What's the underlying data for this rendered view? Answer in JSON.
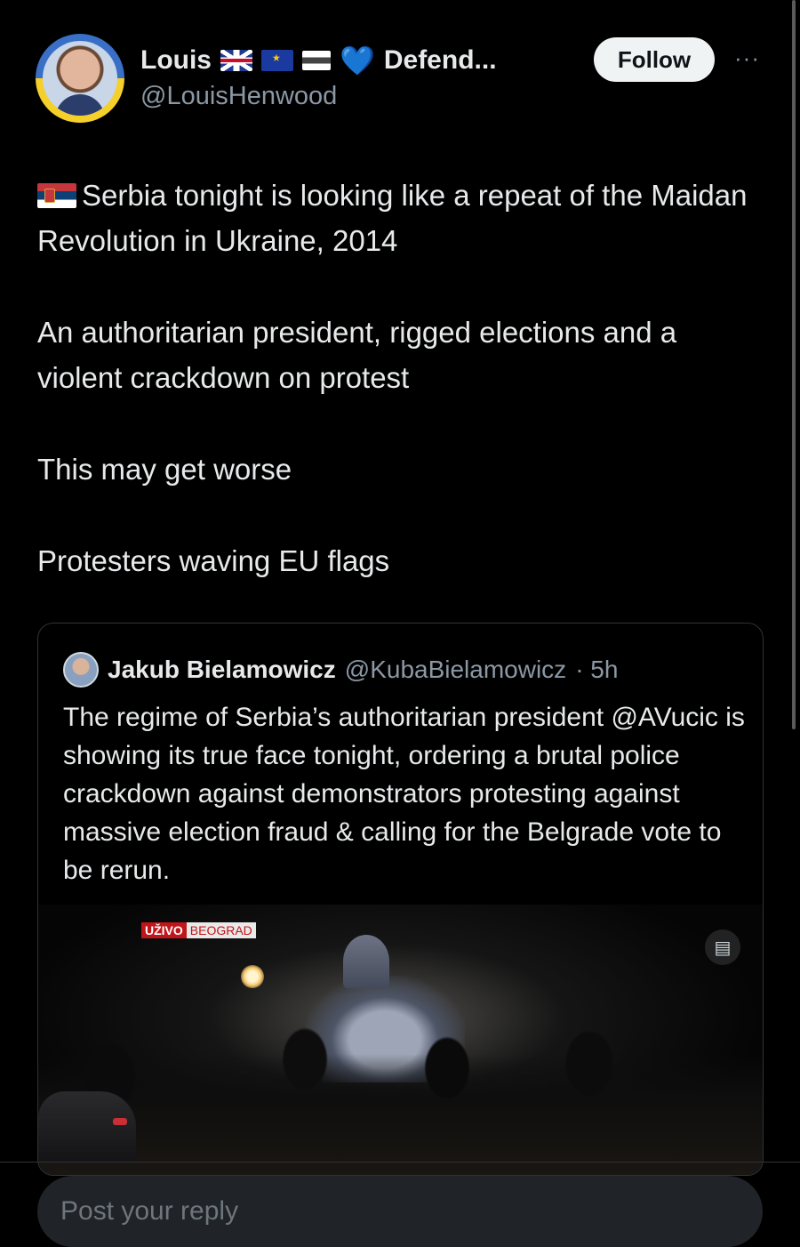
{
  "author": {
    "name": "Louis",
    "flags": [
      "uk-flag",
      "eu-flag",
      "estonia-flag",
      "heart"
    ],
    "name_suffix": "Defend...",
    "handle": "@LouisHenwood",
    "follow_label": "Follow",
    "more_label": "···"
  },
  "tweet": {
    "paragraphs": [
      "Serbia tonight is looking like a repeat of the Maidan Revolution in Ukraine, 2014",
      "An authoritarian president, rigged elections and a violent crackdown on protest",
      "This may get worse",
      "Protesters waving EU flags"
    ]
  },
  "quote": {
    "name": "Jakub Bielamowicz",
    "handle": "@KubaBielamowicz",
    "time": "· 5h",
    "text": "The regime of Serbia’s authoritarian president @AVucic is showing its true face tonight, ordering a brutal police crackdown against demonstrators protesting against massive election fraud & calling for the Belgrade vote to be rerun.",
    "media": {
      "badge_live": "UŽIVO",
      "badge_location": "BEOGRAD"
    }
  },
  "reply": {
    "placeholder": "Post your reply"
  },
  "colors": {
    "background": "#000000",
    "text": "#e7e9ea",
    "secondary": "#8b98a5",
    "heart": "#1d8cf8"
  }
}
